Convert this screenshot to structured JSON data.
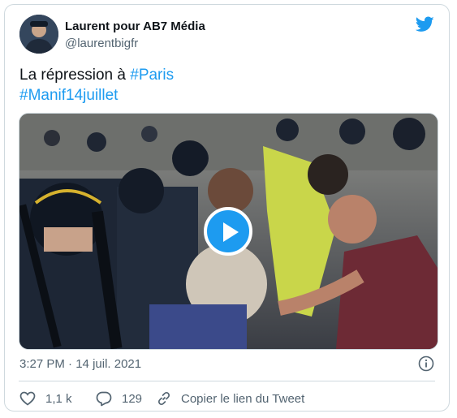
{
  "author": {
    "name": "Laurent pour AB7 Média",
    "handle": "@laurentbigfr"
  },
  "tweet": {
    "text_line1": "La répression à ",
    "hashtag1": "#Paris",
    "hashtag2": "#Manif14juillet"
  },
  "meta": {
    "time": "3:27 PM",
    "separator": " · ",
    "date": "14 juil. 2021"
  },
  "actions": {
    "likes": "1,1 k",
    "replies": "129",
    "copy_link": "Copier le lien du Tweet"
  },
  "colors": {
    "accent": "#1d9bf0",
    "secondary_text": "#536471",
    "border": "#cfd9de"
  },
  "icons": {
    "logo": "twitter-bird-icon",
    "play": "play-icon",
    "info": "info-icon",
    "like": "heart-icon",
    "reply": "reply-bubble-icon",
    "link": "link-icon"
  }
}
